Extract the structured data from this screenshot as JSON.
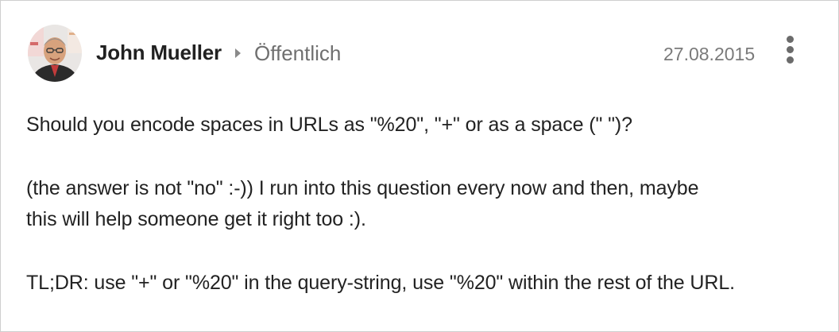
{
  "post": {
    "author_name": "John Mueller",
    "audience": "Öffentlich",
    "date": "27.08.2015",
    "lines": [
      "Should you encode spaces in URLs as \"%20\", \"+\" or as a space (\" \")?",
      "(the answer is not \"no\" :-)) I run into this question every now and then, maybe",
      "this will help someone get it right too :).",
      "TL;DR: use \"+\" or \"%20\" in the query-string, use \"%20\" within the rest of the URL."
    ]
  },
  "icons": {
    "avatar": "author-avatar-photo",
    "audience_chevron": "chevron-right-icon",
    "menu": "more-vert-icon"
  },
  "colors": {
    "author_text": "#212121",
    "secondary_text": "#6f6f6f",
    "body_text": "#222222",
    "border": "#cfcfcf"
  }
}
